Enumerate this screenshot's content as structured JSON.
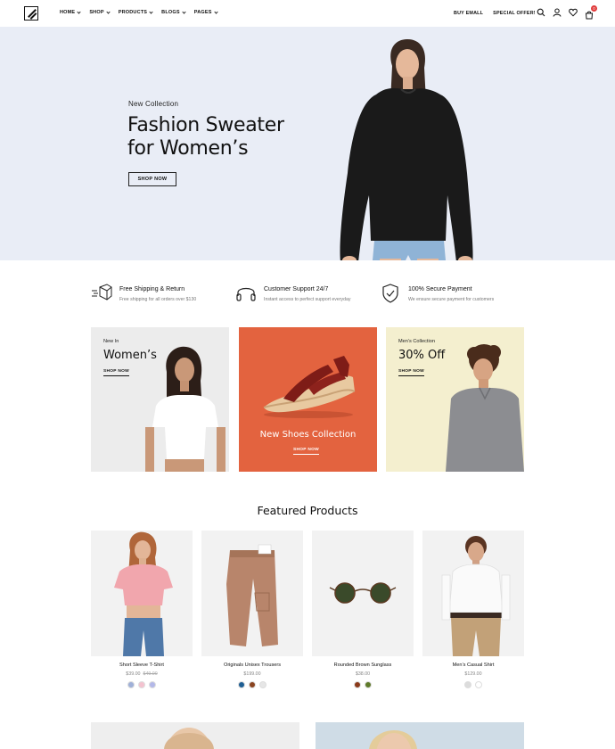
{
  "nav": {
    "items": [
      {
        "label": "HOME"
      },
      {
        "label": "SHOP"
      },
      {
        "label": "PRODUCTS"
      },
      {
        "label": "BLOGS"
      },
      {
        "label": "PAGES"
      }
    ],
    "links": [
      "BUY EMALL",
      "SPECIAL OFFER!"
    ],
    "cart_count": "0"
  },
  "hero": {
    "subtitle": "New Collection",
    "title_line1": "Fashion Sweater",
    "title_line2": "for Women’s",
    "button": "SHOP NOW"
  },
  "features": [
    {
      "title": "Free Shipping & Return",
      "desc": "Free shipping for all orders over $130",
      "icon": "box-icon"
    },
    {
      "title": "Customer Support 24/7",
      "desc": "Instant access to perfect support everyday",
      "icon": "headphones-icon"
    },
    {
      "title": "100% Secure Payment",
      "desc": "We ensure secure payment for customers",
      "icon": "shield-icon"
    }
  ],
  "banners": {
    "women": {
      "small": "New In",
      "big": "Women’s",
      "link": "SHOP NOW"
    },
    "shoes": {
      "title": "New Shoes Collection",
      "link": "SHOP NOW"
    },
    "men": {
      "small": "Men’s Collection",
      "big": "30% Off",
      "link": "SHOP NOW"
    }
  },
  "featured": {
    "title": "Featured Products",
    "products": [
      {
        "name": "Short Sleeve T-Shirt",
        "price": "$39.00",
        "old_price": "$49.00",
        "swatches": [
          "#9fb0d8",
          "#f3c2cf",
          "#b3b8e8"
        ]
      },
      {
        "name": "Originals Unisex Trousers",
        "price": "$199.00",
        "old_price": "",
        "swatches": [
          "#1f5f94",
          "#8a4420",
          "#e6e6e6"
        ]
      },
      {
        "name": "Rounded Brown Sunglass",
        "price": "$38.00",
        "old_price": "",
        "swatches": [
          "#8a3a1a",
          "#5f7a2a"
        ]
      },
      {
        "name": "Men’s Casual Shirt",
        "price": "$129.00",
        "old_price": "",
        "swatches": [
          "#dcdcdc",
          "#ffffff"
        ]
      }
    ]
  }
}
